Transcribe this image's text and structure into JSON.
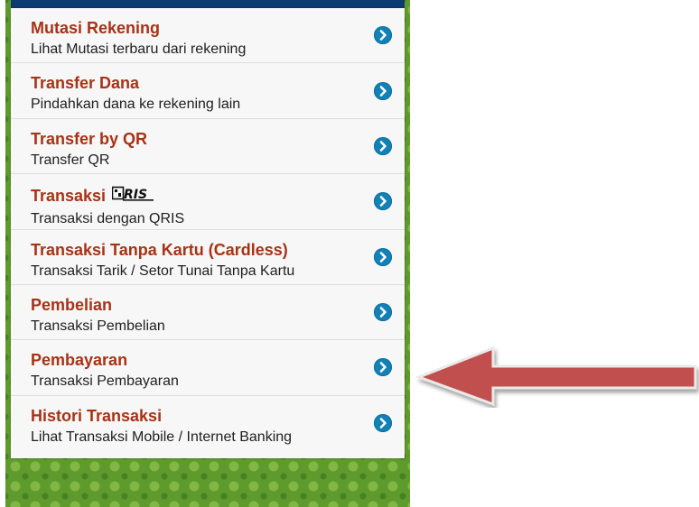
{
  "menu": {
    "items": [
      {
        "title": "Mutasi Rekening",
        "subtitle": "Lihat Mutasi terbaru dari rekening"
      },
      {
        "title": "Transfer Dana",
        "subtitle": "Pindahkan dana ke rekening lain"
      },
      {
        "title": "Transfer by QR",
        "subtitle": "Transfer QR"
      },
      {
        "title": "Transaksi",
        "subtitle": "Transaksi dengan QRIS",
        "logo_text": "QRIS"
      },
      {
        "title": "Transaksi Tanpa Kartu (Cardless)",
        "subtitle": "Transaksi Tarik / Setor Tunai Tanpa Kartu"
      },
      {
        "title": "Pembelian",
        "subtitle": "Transaksi Pembelian"
      },
      {
        "title": "Pembayaran",
        "subtitle": "Transaksi Pembayaran"
      },
      {
        "title": "Histori Transaksi",
        "subtitle": "Lihat Transaksi Mobile / Internet Banking"
      }
    ]
  },
  "colors": {
    "title": "#a83214",
    "chevron": "#1281b6",
    "header_bar": "#0e3a72",
    "background": "#5e9a2c",
    "arrow": "#c0504d"
  },
  "icons": {
    "item_action": "chevron-right-circle-icon",
    "pointer": "left-arrow-annotation"
  },
  "annotation": {
    "points_to_item": "Pembayaran"
  }
}
